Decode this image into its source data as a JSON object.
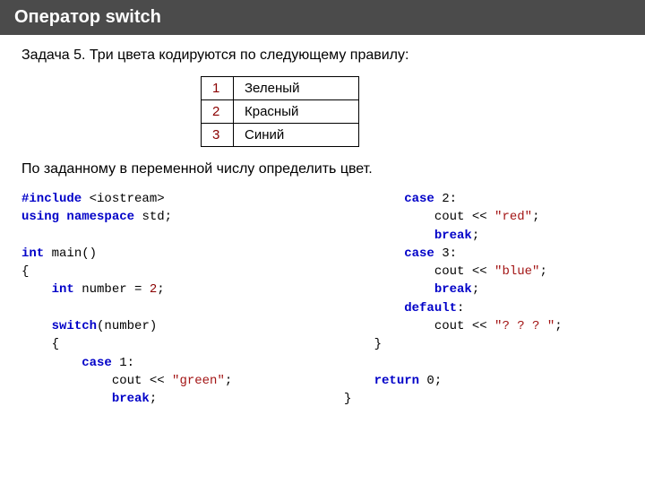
{
  "header": {
    "title": "Оператор switch"
  },
  "task": {
    "intro": "Задача 5. Три цвета кодируются по следующему правилу:",
    "followup": "По заданному в переменной числу определить цвет."
  },
  "table": {
    "rows": [
      {
        "code": "1",
        "name": "Зеленый"
      },
      {
        "code": "2",
        "name": "Красный"
      },
      {
        "code": "3",
        "name": "Синий"
      }
    ]
  },
  "code": {
    "include_hash": "#include",
    "include_lib": " <iostream>",
    "using": "using",
    "namespace": "namespace",
    "std": " std;",
    "int": "int",
    "main": " main()",
    "lbrace": "{",
    "rbrace": "}",
    "number_decl_pre": " number = ",
    "number_val": "2",
    "semicolon": ";",
    "switch": "switch",
    "switch_arg": "(number)",
    "case": "case",
    "c1": " 1",
    "c2": " 2",
    "c3": " 3",
    "colon": ":",
    "default": "default",
    "cout": "cout << ",
    "s_green": "\"green\"",
    "s_red": "\"red\"",
    "s_blue": "\"blue\"",
    "s_q": "\"? ? ? \"",
    "break": "break",
    "return": "return",
    "zero": " 0"
  }
}
